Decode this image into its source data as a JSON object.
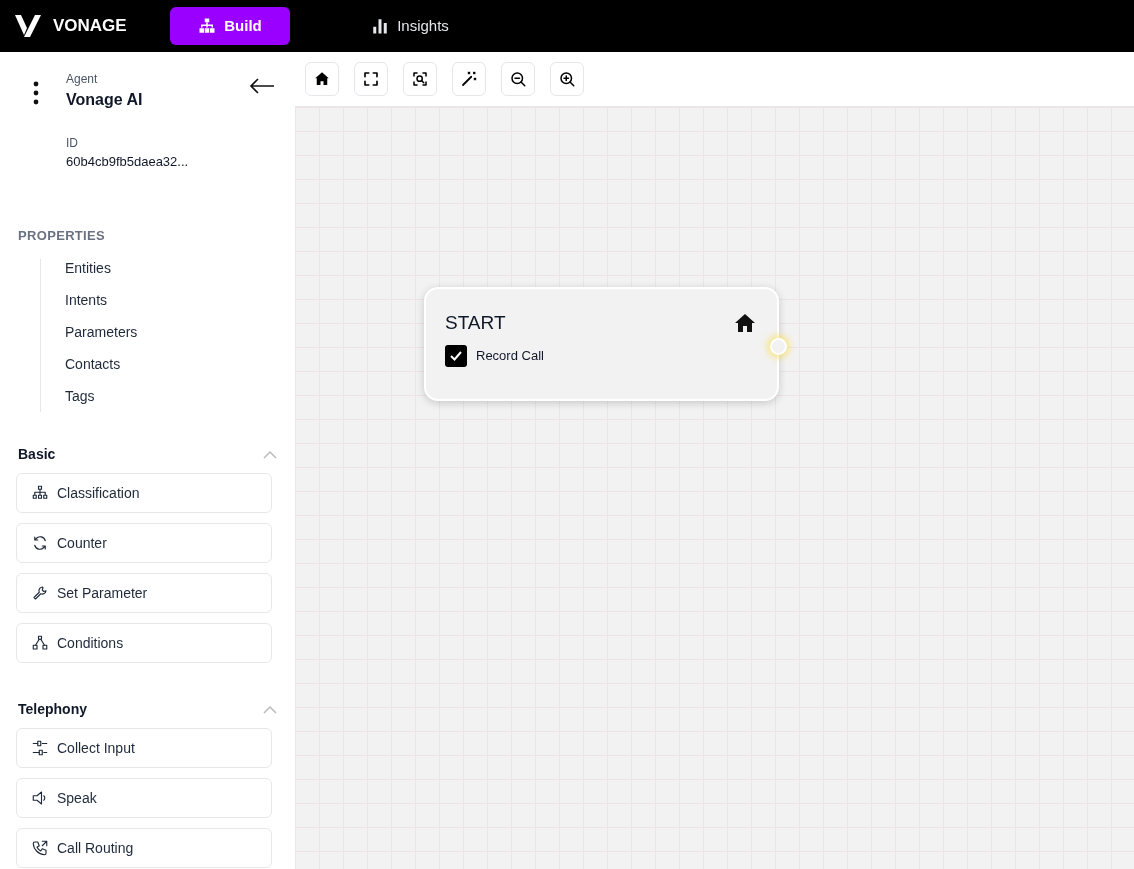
{
  "header": {
    "logo": "VONAGE",
    "tabs": [
      {
        "label": "Build",
        "selected": true
      },
      {
        "label": "Insights",
        "selected": false
      }
    ]
  },
  "agent": {
    "label": "Agent",
    "name": "Vonage AI",
    "id_label": "ID",
    "id": "60b4cb9fb5daea32..."
  },
  "properties": {
    "title": "PROPERTIES",
    "items": [
      "Entities",
      "Intents",
      "Parameters",
      "Contacts",
      "Tags"
    ]
  },
  "sections": [
    {
      "title": "Basic",
      "expanded": true,
      "items": [
        "Classification",
        "Counter",
        "Set Parameter",
        "Conditions"
      ]
    },
    {
      "title": "Telephony",
      "expanded": true,
      "items": [
        "Collect Input",
        "Speak",
        "Call Routing"
      ]
    }
  ],
  "canvas": {
    "node": {
      "title": "START",
      "option": {
        "label": "Record Call",
        "checked": true
      }
    }
  }
}
